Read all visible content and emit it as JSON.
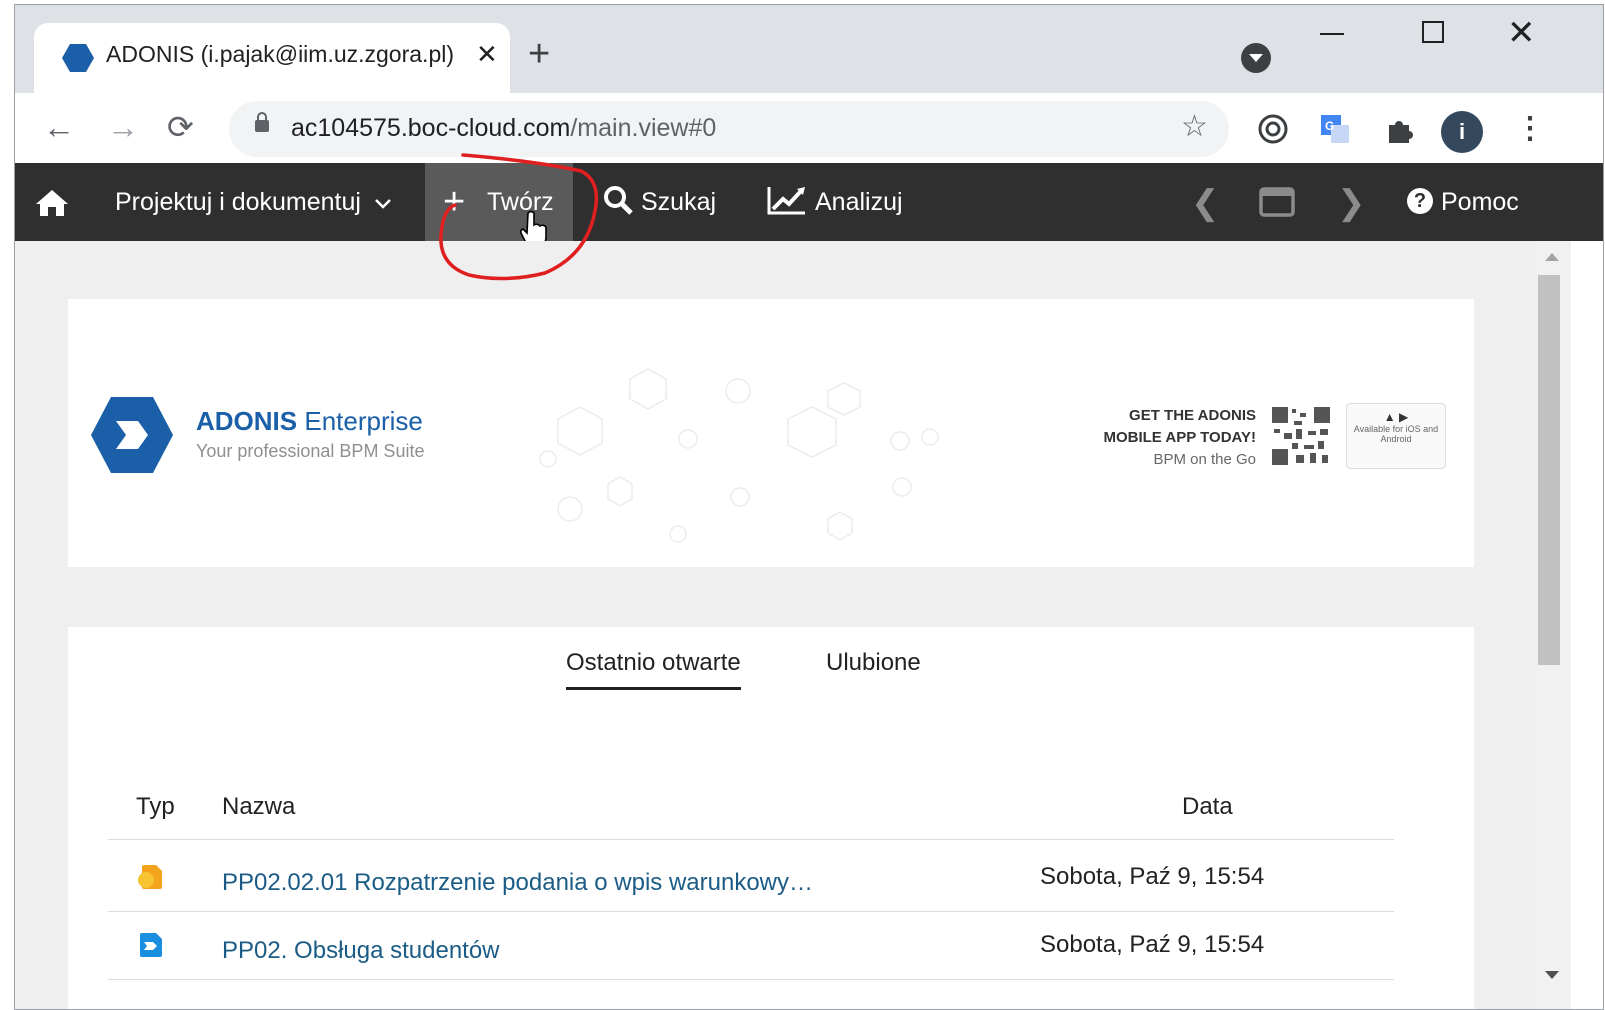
{
  "browser": {
    "tab_title": "ADONIS (i.pajak@iim.uz.zgora.pl)",
    "tab_close": "✕",
    "new_tab": "+",
    "url_host": "ac104575.boc-cloud.com",
    "url_path": "/main.view#0",
    "profile_initial": "i"
  },
  "nav": {
    "design_menu": "Projektuj i dokumentuj",
    "create": "Twórz",
    "search": "Szukaj",
    "analyze": "Analizuj",
    "help": "Pomoc"
  },
  "banner": {
    "brand_bold": "ADONIS",
    "brand_rest": " Enterprise",
    "tagline": "Your professional BPM Suite",
    "promo_line1": "GET THE ADONIS",
    "promo_line2": "MOBILE APP TODAY!",
    "promo_line3": "BPM on the Go",
    "store_text": "Available for iOS and Android"
  },
  "recent": {
    "tabs": [
      "Ostatnio otwarte",
      "Ulubione"
    ],
    "columns": {
      "type": "Typ",
      "name": "Nazwa",
      "date": "Data"
    },
    "rows": [
      {
        "type_icon": "process-model-icon",
        "name": "PP02.02.01 Rozpatrzenie podania o wpis warunkowy…",
        "date": "Sobota, Paź 9, 15:54"
      },
      {
        "type_icon": "process-map-icon",
        "name": "PP02. Obsługa studentów",
        "date": "Sobota, Paź 9, 15:54"
      }
    ]
  },
  "colors": {
    "accent": "#1b5fa8",
    "nav_bg": "#2f2f2f",
    "annotation": "#e02020"
  }
}
